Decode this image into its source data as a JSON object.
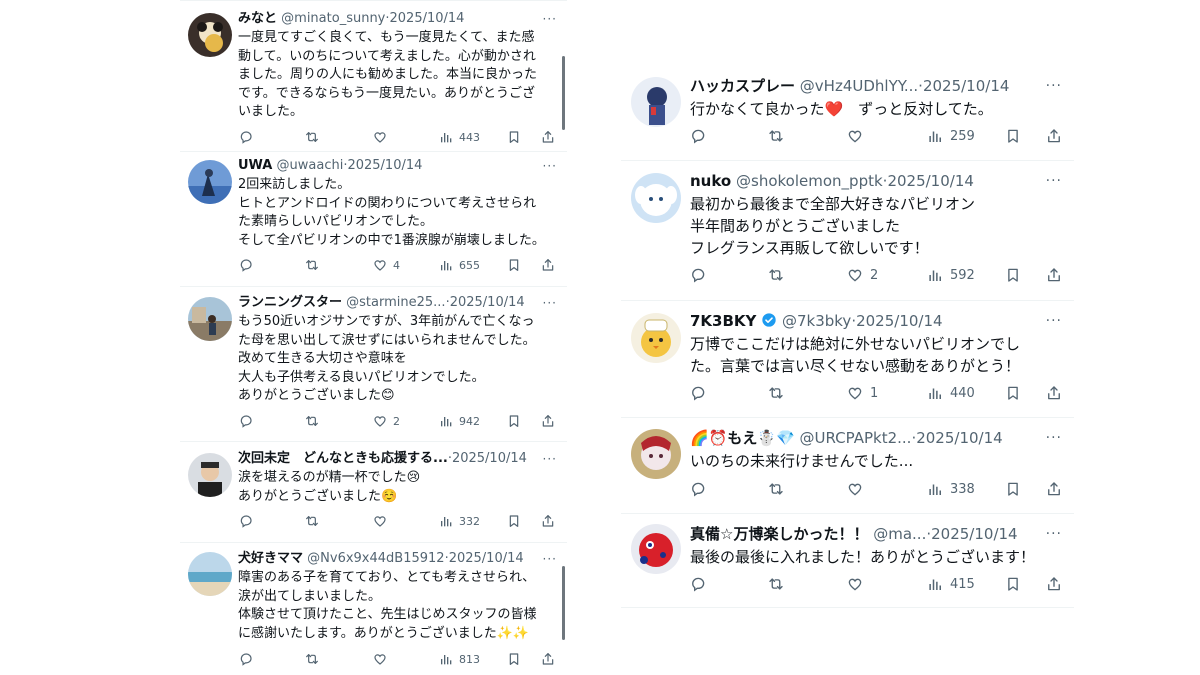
{
  "left": {
    "tweets": [
      {
        "name": "みなと",
        "handle": "@minato_sunny",
        "date": "2025/10/14",
        "text": "一度見てすごく良くて、もう一度見たくて、また感\n動して。いのちについて考えました。心が動かされ\nました。周りの人にも勧めました。本当に良かった\nです。できるならもう一度見たい。ありがとうござ\nいました。",
        "likes": "",
        "views": "443"
      },
      {
        "name": "UWA",
        "handle": "@uwaachi",
        "date": "2025/10/14",
        "text": "2回来訪しました。\nヒトとアンドロイドの関わりについて考えさせられ\nた素晴らしいパビリオンでした。\nそして全パビリオンの中で1番涙腺が崩壊しました。",
        "likes": "4",
        "views": "655"
      },
      {
        "name": "ランニングスター",
        "handle": "@starmine25...",
        "date": "2025/10/14",
        "text": "もう50近いオジサンですが、3年前がんで亡くなっ\nた母を思い出して涙せずにはいられませんでした。\n改めて生きる大切さや意味を\n大人も子供考える良いパビリオンでした。\nありがとうございました😊",
        "likes": "2",
        "views": "942"
      },
      {
        "name": "次回未定　どんなときも応援する...",
        "handle": "",
        "date": "2025/10/14",
        "text": "涙を堪えるのが精一杯でした😢\nありがとうございました☺️",
        "likes": "",
        "views": "332"
      },
      {
        "name": "犬好きママ",
        "handle": "@Nv6x9x44dB15912",
        "date": "2025/10/14",
        "text": "障害のある子を育てており、とても考えさせられ、\n涙が出てしまいました。\n体験させて頂けたこと、先生はじめスタッフの皆様\nに感謝いたします。ありがとうございました✨✨",
        "likes": "",
        "views": "813"
      }
    ]
  },
  "right": {
    "tweets": [
      {
        "name": "ハッカスプレー",
        "handle": "@vHz4UDhlYY...",
        "date": "2025/10/14",
        "text": "行かなくて良かった❤️　ずっと反対してた。",
        "likes": "",
        "views": "259"
      },
      {
        "name": "nuko",
        "handle": "@shokolemon_pptk",
        "date": "2025/10/14",
        "text": "最初から最後まで全部大好きなパビリオン\n半年間ありがとうございました\nフレグランス再販して欲しいです！",
        "likes": "2",
        "views": "592"
      },
      {
        "name": "7K3BKY",
        "handle": "@7k3bky",
        "date": "2025/10/14",
        "text": "万博でここだけは絶対に外せないパビリオンでし\nた。言葉では言い尽くせない感動をありがとう！",
        "likes": "1",
        "views": "440"
      },
      {
        "name": "🌈⏰もえ☃️💎",
        "handle": "@URCPAPkt2...",
        "date": "2025/10/14",
        "text": "いのちの未来行けませんでした...",
        "likes": "",
        "views": "338"
      },
      {
        "name": "真備☆万博楽しかった！！",
        "handle": "@ma...",
        "date": "2025/10/14",
        "text": "最後の最後に入れました！ありがとうございます！",
        "likes": "",
        "views": "415"
      }
    ]
  },
  "ui": {
    "separator": "·",
    "more_glyph": "···",
    "verified_color": "#1d9bf0",
    "text_color": "#0f1419",
    "muted_color": "#536471",
    "divider_color": "#eff3f4",
    "icons": [
      "reply-icon",
      "retweet-icon",
      "like-icon",
      "views-icon",
      "bookmark-icon",
      "share-icon"
    ]
  }
}
